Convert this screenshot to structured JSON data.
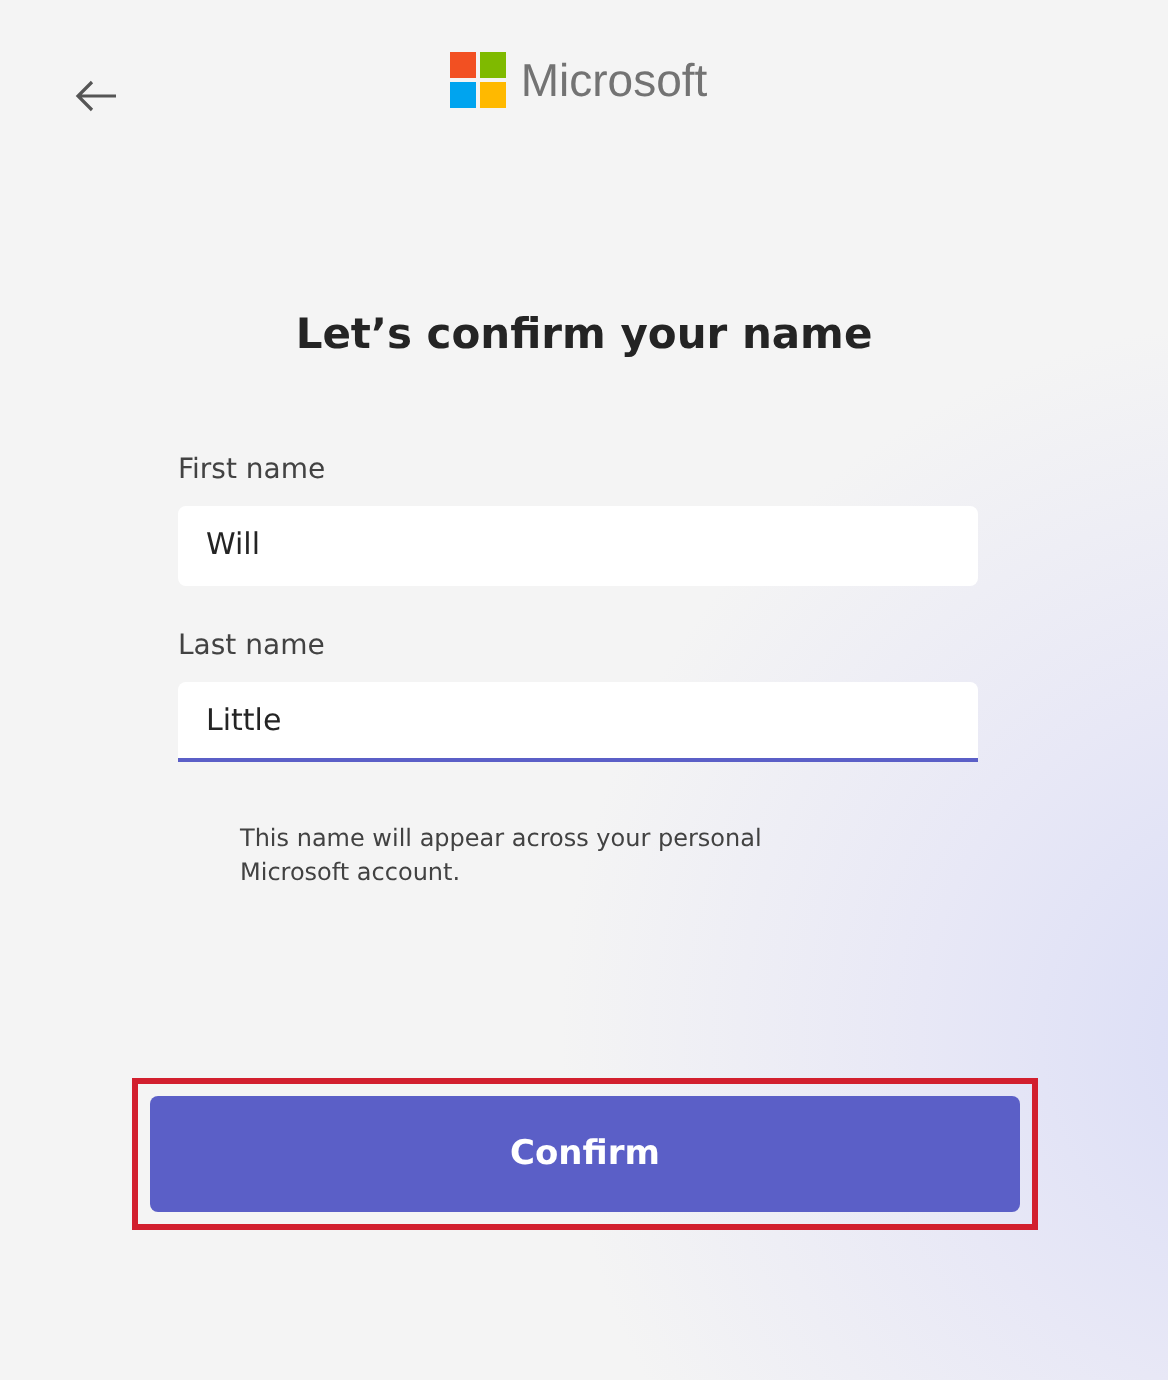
{
  "header": {
    "back": true,
    "brand": "Microsoft"
  },
  "title": "Let’s confirm your name",
  "fields": [
    {
      "label": "First name",
      "value": "Will",
      "focused": false
    },
    {
      "label": "Last name",
      "value": "Little",
      "focused": true
    }
  ],
  "helper_text": "This name will appear across your personal Microsoft account.",
  "confirm_button": {
    "label": "Confirm",
    "highlighted": true
  }
}
